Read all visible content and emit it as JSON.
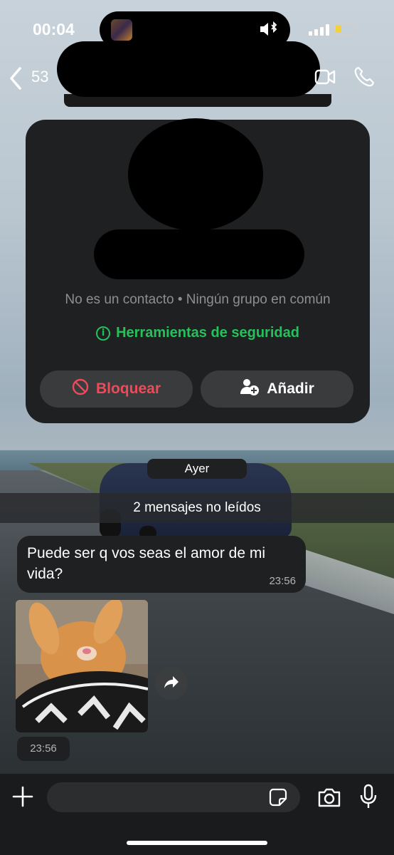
{
  "status_bar": {
    "time": "00:04"
  },
  "header": {
    "back_count": "53"
  },
  "contact_card": {
    "subtitle": "No es un contacto • Ningún grupo en común",
    "security_tools": "Herramientas de seguridad",
    "block_label": "Bloquear",
    "add_label": "Añadir"
  },
  "chat": {
    "date_pill": "Ayer",
    "unread_banner": "2 mensajes no leídos",
    "messages": [
      {
        "text": "Puede ser q vos seas el amor de mi vida?",
        "time": "23:56"
      },
      {
        "type": "image",
        "time": "23:56"
      }
    ]
  },
  "input_bar": {
    "placeholder": ""
  },
  "colors": {
    "accent_green": "#25c25c",
    "danger_red": "#ef4a5a",
    "bubble_bg": "#1f2021"
  },
  "icons": [
    "chevron-left-icon",
    "video-call-icon",
    "phone-icon",
    "info-icon",
    "block-icon",
    "add-contact-icon",
    "forward-icon",
    "plus-icon",
    "sticker-icon",
    "camera-icon",
    "microphone-icon"
  ]
}
